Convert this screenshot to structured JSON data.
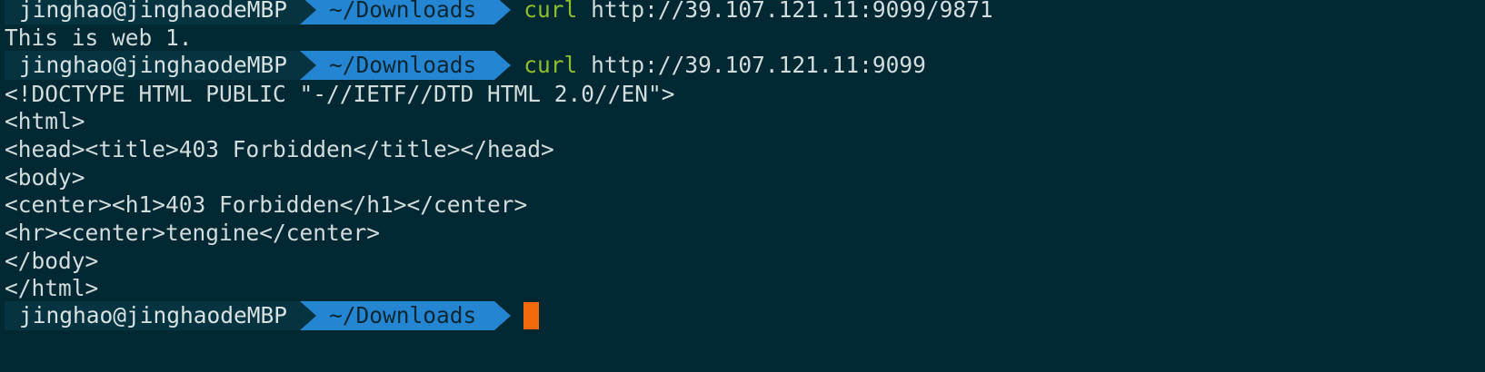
{
  "theme": {
    "background": "#012833",
    "text": "#d3dcdc",
    "user_segment_bg": "#063340",
    "dir_segment_bg": "#2486d3",
    "command_color": "#8dbd2d",
    "cursor_color": "#f26a0b"
  },
  "prompt": {
    "user_host": "jinghao@jinghaodeMBP",
    "directory": "~/Downloads"
  },
  "session": {
    "cmd1": {
      "name": "curl",
      "arg": "http://39.107.121.11:9099/9871"
    },
    "out1": [
      "This is web 1."
    ],
    "cmd2": {
      "name": "curl",
      "arg": "http://39.107.121.11:9099"
    },
    "out2": [
      "<!DOCTYPE HTML PUBLIC \"-//IETF//DTD HTML 2.0//EN\">",
      "<html>",
      "<head><title>403 Forbidden</title></head>",
      "<body>",
      "<center><h1>403 Forbidden</h1></center>",
      "<hr><center>tengine</center>",
      "</body>",
      "</html>"
    ]
  }
}
